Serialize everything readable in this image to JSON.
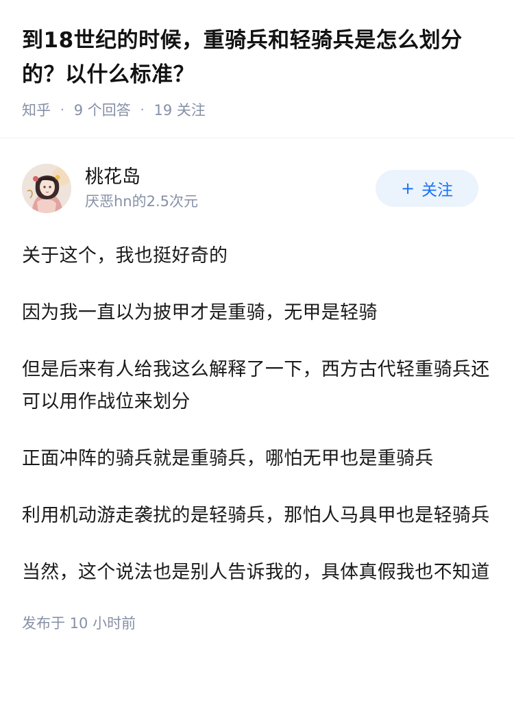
{
  "question": {
    "title": "到18世纪的时候，重骑兵和轻骑兵是怎么划分的？以什么标准？",
    "source": "知乎",
    "answers_count": "9 个回答",
    "followers_count": "19 关注"
  },
  "answer": {
    "author": {
      "name": "桃花岛",
      "bio": "厌恶hn的2.5次元",
      "avatar_icon": "avatar-image"
    },
    "follow_button": {
      "icon": "+",
      "label": "关注"
    },
    "paragraphs": [
      "关于这个，我也挺好奇的",
      "因为我一直以为披甲才是重骑，无甲是轻骑",
      "但是后来有人给我这么解释了一下，西方古代轻重骑兵还可以用作战位来划分",
      "正面冲阵的骑兵就是重骑兵，哪怕无甲也是重骑兵",
      "利用机动游走袭扰的是轻骑兵，那怕人马具甲也是轻骑兵",
      "当然，这个说法也是别人告诉我的，具体真假我也不知道"
    ],
    "published": "发布于 10 小时前"
  },
  "colors": {
    "title": "#121212",
    "meta": "#8590a6",
    "follow_text": "#1772f6",
    "follow_bg": "#ebf3fd"
  }
}
